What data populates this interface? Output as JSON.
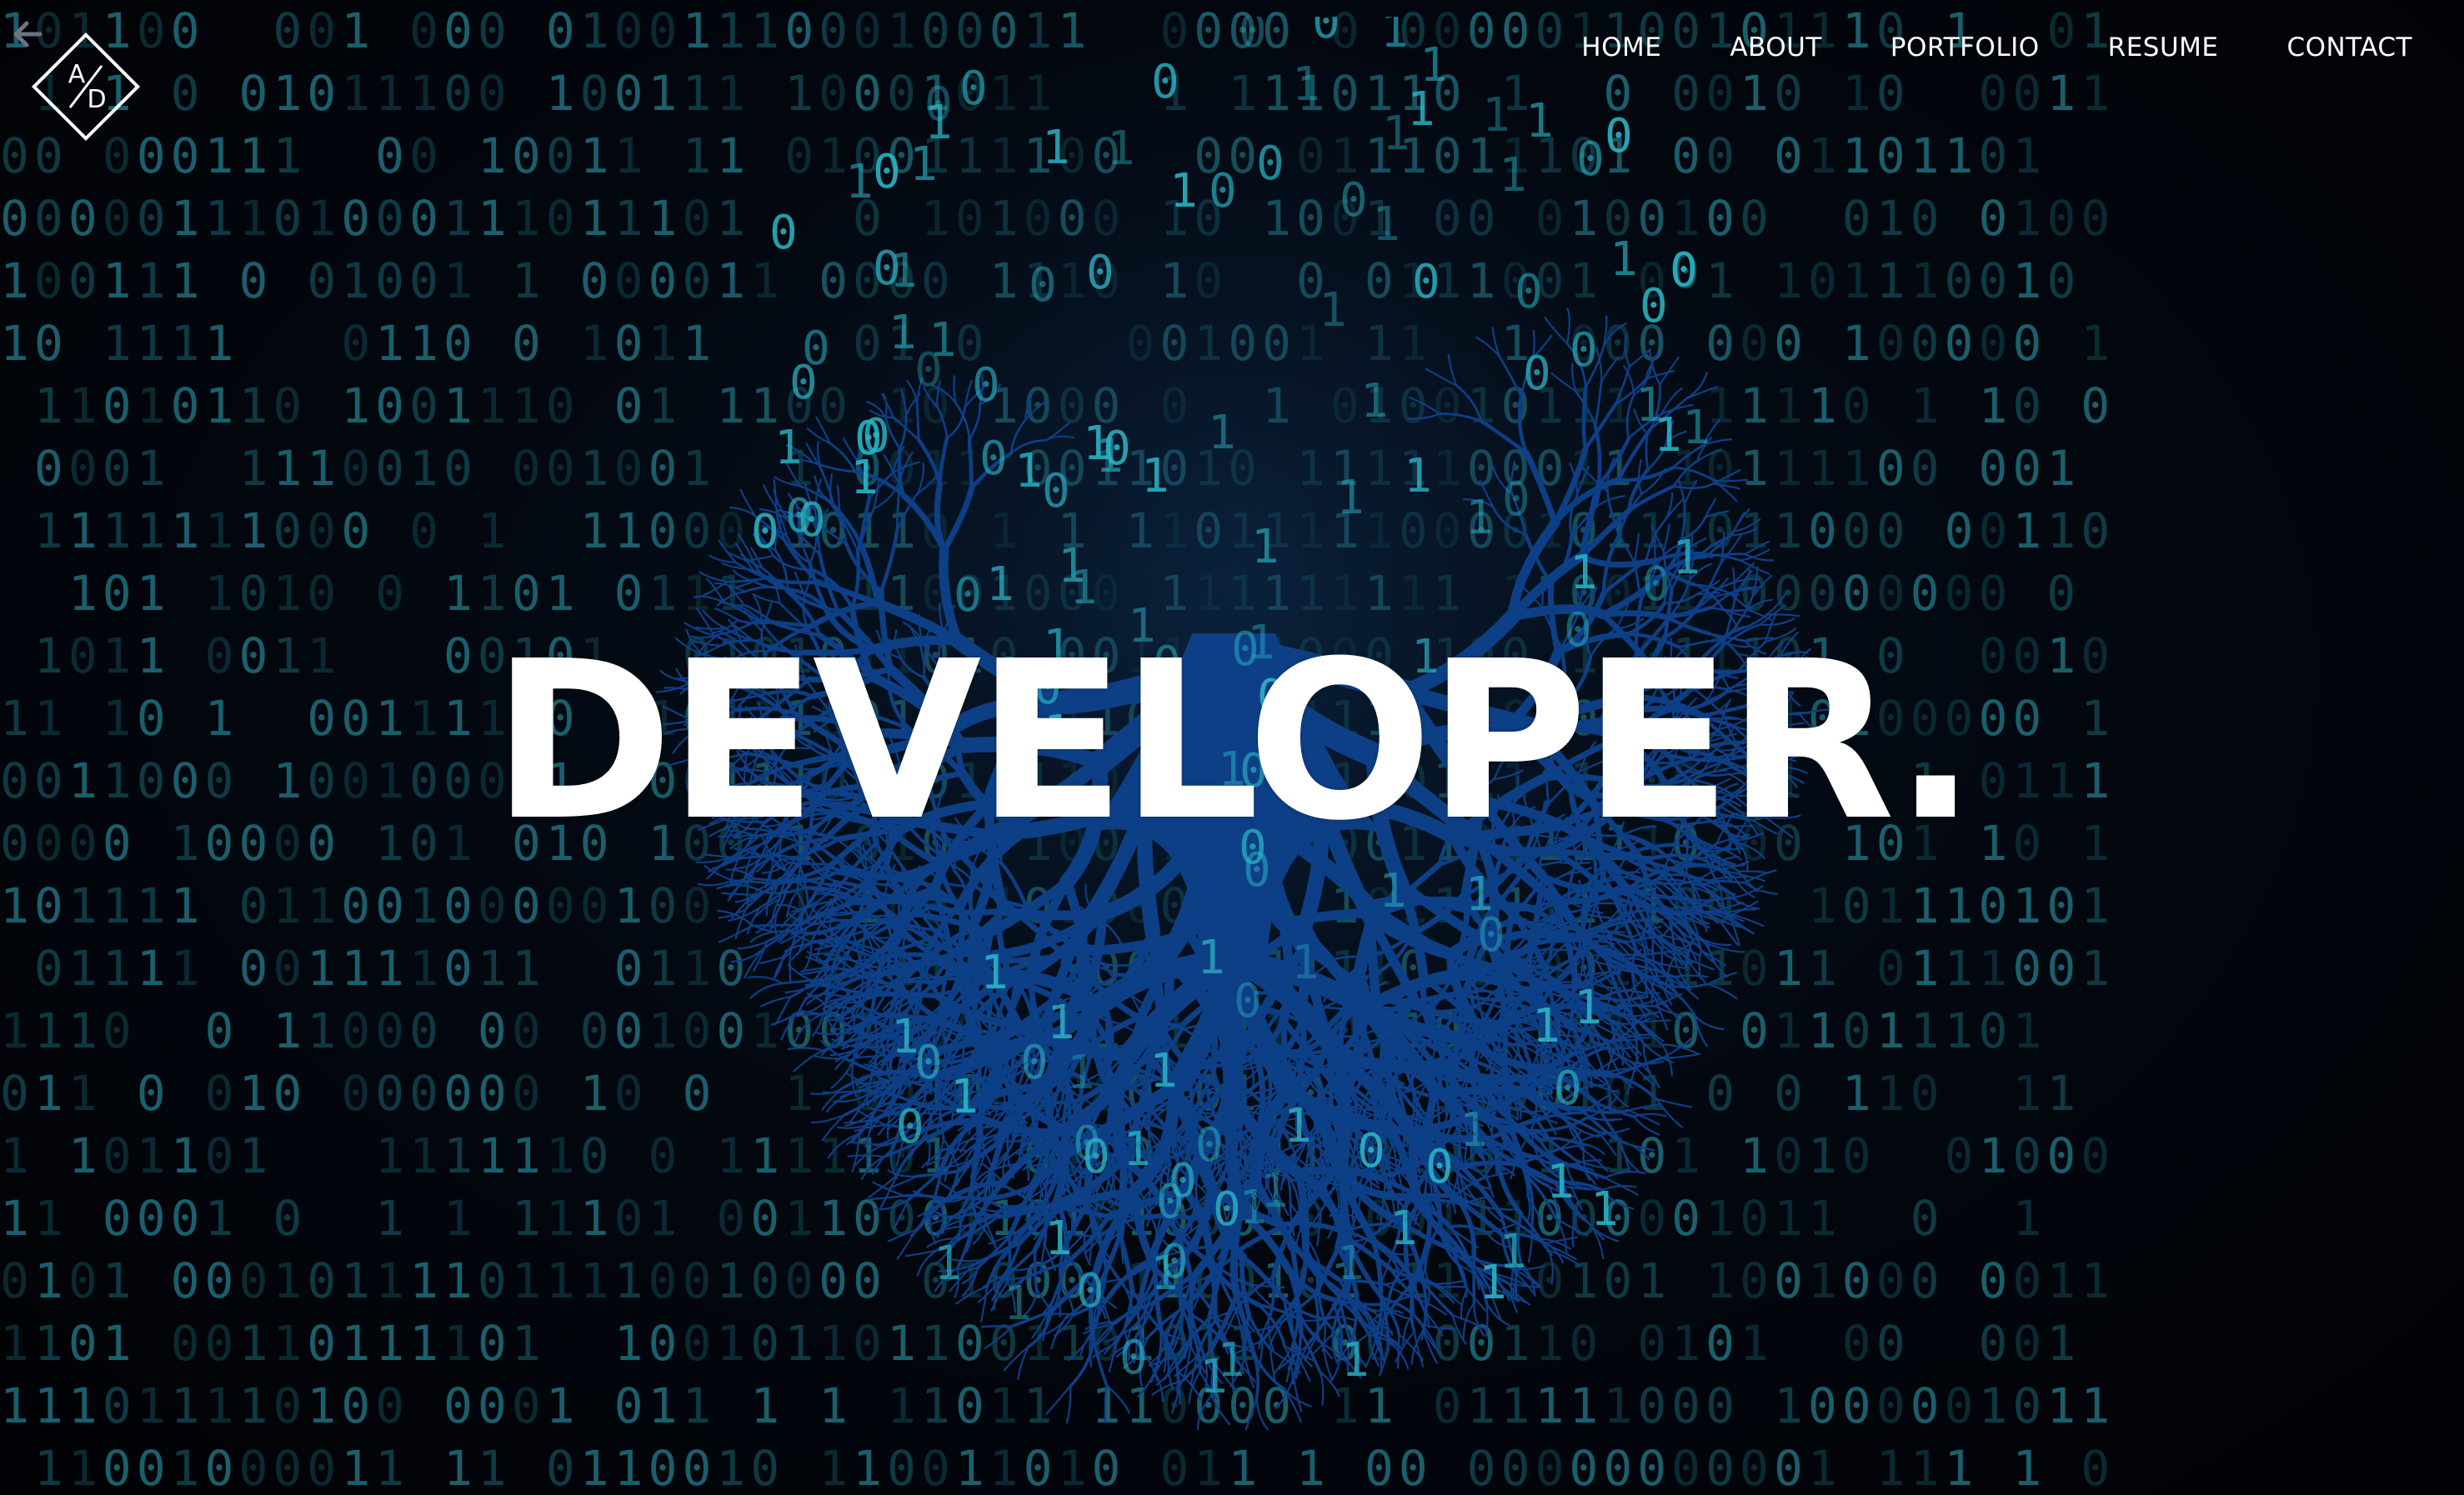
{
  "header": {
    "back_icon": "arrow-left-icon",
    "logo": {
      "top_letter": "A",
      "bottom_letter": "D"
    },
    "nav": [
      {
        "label": "HOME"
      },
      {
        "label": "ABOUT"
      },
      {
        "label": "PORTFOLIO"
      },
      {
        "label": "RESUME"
      },
      {
        "label": "CONTACT"
      }
    ]
  },
  "hero": {
    "headline": "DEVELOPER."
  },
  "colors": {
    "background": "#020408",
    "binary_digits": "#1a5f6c",
    "tree": "#0d3f86",
    "headline": "#ffffff"
  }
}
